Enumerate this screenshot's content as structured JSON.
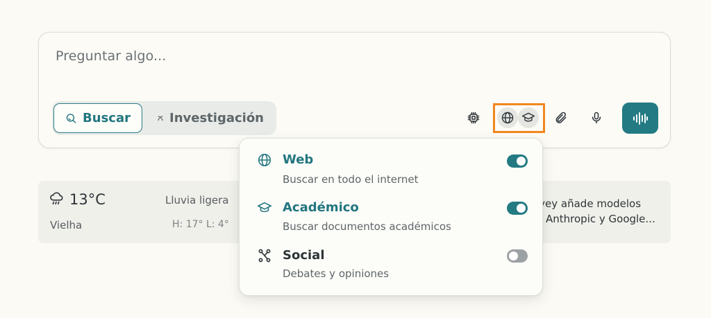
{
  "query": {
    "placeholder": "Preguntar algo..."
  },
  "modes": {
    "search_label": "Buscar",
    "research_label": "Investigación"
  },
  "toolbar": {
    "model_icon": "chip-icon",
    "sources_icons": [
      "globe-icon",
      "graduation-cap-icon"
    ],
    "attach_icon": "paperclip-icon",
    "mic_icon": "microphone-icon",
    "voice_icon": "waveform-icon"
  },
  "weather": {
    "temperature": "13°C",
    "condition": "Lluvia ligera",
    "location": "Vielha",
    "high_low": "H: 17° L: 4°"
  },
  "news": {
    "line1": "rvey añade modelos",
    "line2": "Anthropic y Google..."
  },
  "sources_menu": {
    "options": [
      {
        "title": "Web",
        "description": "Buscar en todo el internet",
        "enabled": true
      },
      {
        "title": "Académico",
        "description": "Buscar documentos académicos",
        "enabled": true
      },
      {
        "title": "Social",
        "description": "Debates y opiniones",
        "enabled": false
      }
    ]
  },
  "colors": {
    "accent": "#237a83",
    "highlight": "#f2871e",
    "background": "#fbfaf4"
  }
}
